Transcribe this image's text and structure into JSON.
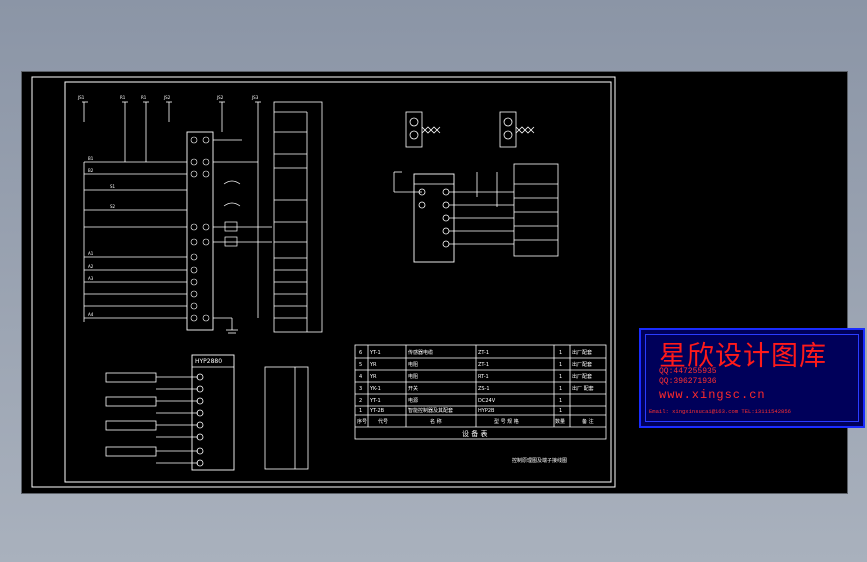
{
  "drawing": {
    "top_left_terminals": [
      "JS1",
      "R1",
      "R1",
      "JS2",
      "JS2",
      "JS3"
    ],
    "left_contacts": [
      "B1",
      "B2",
      "S1",
      "S2",
      "A1",
      "A2",
      "A3",
      "A4"
    ],
    "table_title": "设 备 表",
    "table_headers": [
      "序号",
      "代号",
      "名 称",
      "型 号 规 格",
      "数量",
      "备 注"
    ],
    "table_rows": [
      {
        "no": "6",
        "code": "YT-1",
        "name": "传感器电缆",
        "spec": "ZT-1",
        "qty": "1",
        "note": "出厂配套"
      },
      {
        "no": "5",
        "code": "YR",
        "name": "电阻",
        "spec": "ZT-1",
        "qty": "1",
        "note": "出厂配套"
      },
      {
        "no": "4",
        "code": "YR",
        "name": "电阻",
        "spec": "RT-1",
        "qty": "1",
        "note": "出厂配套"
      },
      {
        "no": "3",
        "code": "YK-1",
        "name": "开关",
        "spec": "ZS-1",
        "qty": "1",
        "note": "出厂 配套"
      },
      {
        "no": "2",
        "code": "YT-1",
        "name": "电源",
        "spec": "DC24V",
        "qty": "1",
        "note": ""
      },
      {
        "no": "1",
        "code": "YT-2B",
        "name": "智能控制器及其配套",
        "spec": "HYP2B",
        "qty": "1",
        "note": ""
      }
    ],
    "device_labels": [
      "HYP2880",
      "HYP2880"
    ],
    "footer_caption": "控制原理图及端子接线图"
  },
  "watermark": {
    "title": "星欣设计图库",
    "qq1": "QQ:447255935",
    "qq2": "QQ:396271936",
    "url": "www.xingsc.cn",
    "footer": "Email: xingxinsucai@163.com  TEL:13111542856"
  },
  "colors": {
    "line": "#ffffff",
    "cyan": "#00ffff",
    "red": "#ff2020",
    "yellow": "#ffff00",
    "background": "#000000",
    "watermark_border": "#1a2cff"
  }
}
